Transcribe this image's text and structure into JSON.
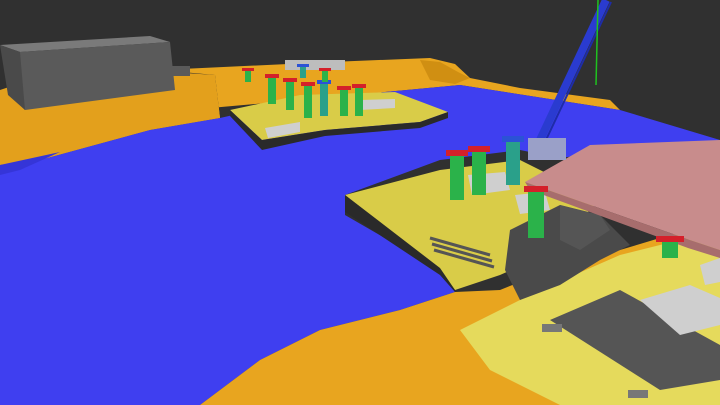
{
  "viewer": {
    "background_color": "#303030",
    "render_mode": "3d-model-viewer"
  },
  "palette": {
    "water": "#3f3ff0",
    "water_shade": "#3535d8",
    "land_orange": "#e8a51f",
    "land_orange_dark": "#d08f12",
    "land_yellow": "#d9cc48",
    "land_yellow_light": "#e5da5c",
    "warehouse_gray": "#5a5a5a",
    "warehouse_top": "#7a7a7a",
    "dark_structure": "#4a4a4a",
    "sheet_pile": "#2a2a2a",
    "slab_light": "#c9c9c9",
    "bridge_deck_pink": "#c88c8c",
    "bridge_deck_side": "#a76d6d",
    "crane_blue": "#2a3bd0",
    "crane_green_line": "#1fc21f",
    "tower_green": "#2bb24a",
    "tower_teal": "#2aa08a",
    "tower_red": "#d4202a",
    "tower_blue": "#2b52d6"
  },
  "scene_objects": {
    "warehouse": "warehouse-block",
    "upper_pier": "upper-pier",
    "lower_pier": "lower-pier",
    "bridge_deck": "bridge-deck",
    "crawler_crane": "crawler-crane-boom",
    "shoring_towers_upper": 9,
    "shoring_towers_lower": 4
  }
}
